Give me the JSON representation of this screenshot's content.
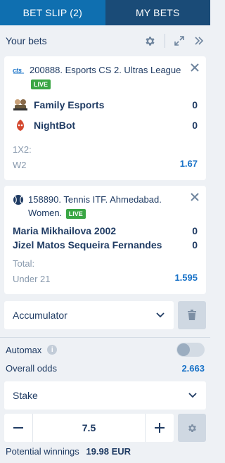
{
  "tabs": [
    {
      "label": "BET SLIP (2)",
      "active": true
    },
    {
      "label": "MY BETS",
      "active": false
    }
  ],
  "header": {
    "title": "Your bets"
  },
  "bets": [
    {
      "event_id": "200888.",
      "event_name": "Esports CS 2. Ultras League",
      "live_label": "LIVE",
      "sport_icon": "esports-icon",
      "teams": [
        {
          "name": "Family Esports",
          "score": "0",
          "icon": "team-logo-family-esports-icon"
        },
        {
          "name": "NightBot",
          "score": "0",
          "icon": "team-logo-nightbot-icon"
        }
      ],
      "market": "1X2:",
      "selection": "W2",
      "odds": "1.67"
    },
    {
      "event_id": "158890.",
      "event_name": "Tennis ITF. Ahmedabad. Women.",
      "live_label": "LIVE",
      "sport_icon": "tennis-ball-icon",
      "teams": [
        {
          "name": "Maria Mikhailova 2002",
          "score": "0"
        },
        {
          "name": "Jizel Matos Sequeira Fernandes",
          "score": "0"
        }
      ],
      "market": "Total:",
      "selection": "Under 21",
      "odds": "1.595"
    }
  ],
  "bet_type": {
    "selected": "Accumulator"
  },
  "automax": {
    "label": "Automax",
    "info": "i",
    "enabled": false
  },
  "overall_odds": {
    "label": "Overall odds",
    "value": "2.663"
  },
  "stake": {
    "label": "Stake",
    "value": "7.5"
  },
  "potential_winnings": {
    "label": "Potential winnings",
    "value": "19.98 EUR"
  },
  "colors": {
    "accent": "#1a73c8",
    "tab_active": "#0f6fb0",
    "tab_inactive": "#1a4b77",
    "live": "#3aa644"
  }
}
